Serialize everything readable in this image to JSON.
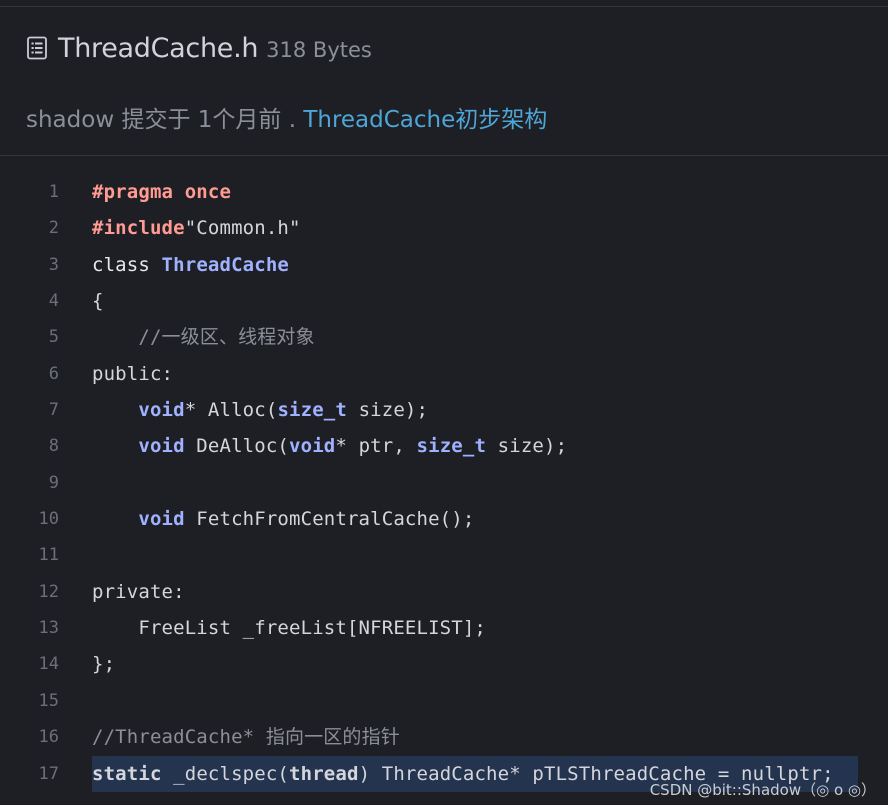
{
  "file": {
    "icon": "file-text-icon",
    "name": "ThreadCache.h",
    "size": "318 Bytes"
  },
  "commit": {
    "prefix": "shadow 提交于 1个月前 . ",
    "message": "ThreadCache初步架构"
  },
  "lines": [
    {
      "n": "1",
      "tokens": [
        {
          "t": "#pragma once",
          "k": "directive"
        }
      ]
    },
    {
      "n": "2",
      "tokens": [
        {
          "t": "#include",
          "k": "directive"
        },
        {
          "t": "\"Common.h\"",
          "k": "string"
        }
      ]
    },
    {
      "n": "3",
      "tokens": [
        {
          "t": "class ",
          "k": "keyword"
        },
        {
          "t": "ThreadCache",
          "k": "classname"
        }
      ]
    },
    {
      "n": "4",
      "tokens": [
        {
          "t": "{",
          "k": "plain"
        }
      ]
    },
    {
      "n": "5",
      "tokens": [
        {
          "t": "    //一级区、线程对象",
          "k": "comment"
        }
      ]
    },
    {
      "n": "6",
      "tokens": [
        {
          "t": "public:",
          "k": "plain"
        }
      ]
    },
    {
      "n": "7",
      "tokens": [
        {
          "t": "    ",
          "k": "plain"
        },
        {
          "t": "void",
          "k": "type"
        },
        {
          "t": "* Alloc(",
          "k": "plain"
        },
        {
          "t": "size_t",
          "k": "type"
        },
        {
          "t": " size);",
          "k": "plain"
        }
      ]
    },
    {
      "n": "8",
      "tokens": [
        {
          "t": "    ",
          "k": "plain"
        },
        {
          "t": "void",
          "k": "type"
        },
        {
          "t": " DeAlloc(",
          "k": "plain"
        },
        {
          "t": "void",
          "k": "type"
        },
        {
          "t": "* ptr, ",
          "k": "plain"
        },
        {
          "t": "size_t",
          "k": "type"
        },
        {
          "t": " size);",
          "k": "plain"
        }
      ]
    },
    {
      "n": "9",
      "tokens": []
    },
    {
      "n": "10",
      "tokens": [
        {
          "t": "    ",
          "k": "plain"
        },
        {
          "t": "void",
          "k": "type"
        },
        {
          "t": " FetchFromCentralCache();",
          "k": "plain"
        }
      ]
    },
    {
      "n": "11",
      "tokens": []
    },
    {
      "n": "12",
      "tokens": [
        {
          "t": "private:",
          "k": "plain"
        }
      ]
    },
    {
      "n": "13",
      "tokens": [
        {
          "t": "    FreeList _freeList[NFREELIST];",
          "k": "plain"
        }
      ]
    },
    {
      "n": "14",
      "tokens": [
        {
          "t": "};",
          "k": "plain"
        }
      ]
    },
    {
      "n": "15",
      "tokens": []
    },
    {
      "n": "16",
      "tokens": [
        {
          "t": "//ThreadCache* 指向一区的指针",
          "k": "comment"
        }
      ]
    },
    {
      "n": "17",
      "highlight": true,
      "tokens": [
        {
          "t": "static",
          "k": "bold"
        },
        {
          "t": " _declspec(",
          "k": "plain"
        },
        {
          "t": "thread",
          "k": "bold"
        },
        {
          "t": ") ThreadCache* pTLSThreadCache = nullptr;",
          "k": "plain"
        }
      ]
    }
  ],
  "watermark": "CSDN @bit::Shadow（◎ o ◎）",
  "colors": {
    "background": "#1e1f24",
    "link": "#4ea5d6",
    "directive": "#ff9b93",
    "type": "#9fb1ff",
    "highlight": "#233450"
  }
}
